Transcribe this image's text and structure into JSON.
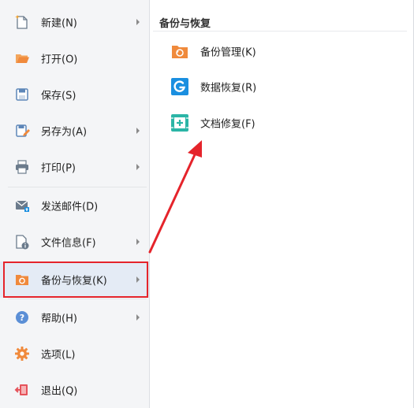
{
  "menu": {
    "items": [
      {
        "label": "新建(N)",
        "icon": "new-document-icon",
        "has_submenu": true
      },
      {
        "label": "打开(O)",
        "icon": "folder-open-icon",
        "has_submenu": false
      },
      {
        "label": "保存(S)",
        "icon": "save-icon",
        "has_submenu": false
      },
      {
        "label": "另存为(A)",
        "icon": "save-as-icon",
        "has_submenu": true
      },
      {
        "label": "打印(P)",
        "icon": "printer-icon",
        "has_submenu": true
      },
      {
        "label": "发送邮件(D)",
        "icon": "mail-icon",
        "has_submenu": false
      },
      {
        "label": "文件信息(F)",
        "icon": "file-info-icon",
        "has_submenu": true
      },
      {
        "label": "备份与恢复(K)",
        "icon": "backup-folder-icon",
        "has_submenu": true,
        "active": true
      },
      {
        "label": "帮助(H)",
        "icon": "help-icon",
        "has_submenu": true
      },
      {
        "label": "选项(L)",
        "icon": "gear-icon",
        "has_submenu": false
      },
      {
        "label": "退出(Q)",
        "icon": "exit-icon",
        "has_submenu": false
      }
    ]
  },
  "submenu": {
    "title": "备份与恢复",
    "items": [
      {
        "label": "备份管理(K)",
        "icon": "backup-manage-icon"
      },
      {
        "label": "数据恢复(R)",
        "icon": "data-recovery-icon"
      },
      {
        "label": "文档修复(F)",
        "icon": "document-repair-icon"
      }
    ]
  },
  "colors": {
    "accent_orange": "#f08a3c",
    "highlight_red": "#e5242b",
    "active_bg": "#e4ebf5",
    "recovery_blue": "#1a8fe0",
    "repair_teal": "#2bb5a6"
  }
}
